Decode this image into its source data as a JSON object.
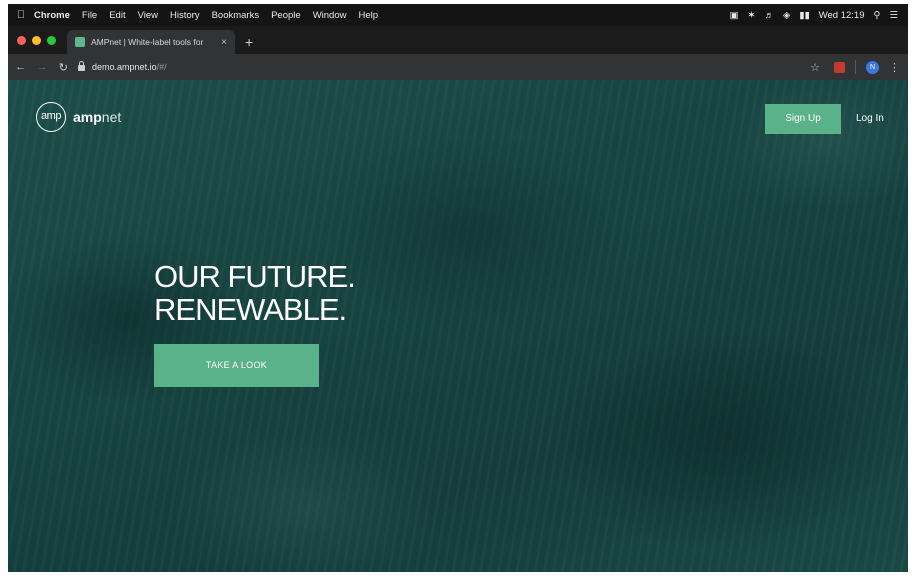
{
  "menubar": {
    "app_name": "Chrome",
    "items": [
      "File",
      "Edit",
      "View",
      "History",
      "Bookmarks",
      "People",
      "Window",
      "Help"
    ],
    "clock": "Wed 12:19"
  },
  "browser": {
    "tab_title": "AMPnet | White-label tools for",
    "tab_close": "×",
    "new_tab": "+",
    "url_domain": "demo.ampnet.io",
    "url_path": "/#/",
    "profile_initial": "N"
  },
  "page": {
    "logo_mark": "amp",
    "logo_word_bold": "amp",
    "logo_word_light": "net",
    "signup_label": "Sign Up",
    "login_label": "Log In",
    "hero_line1": "OUR FUTURE.",
    "hero_line2": "RENEWABLE.",
    "cta_label": "TAKE A LOOK"
  },
  "colors": {
    "accent_green": "#5ab28a",
    "ocean_teal": "#174542",
    "close_red": "#ff5f57",
    "minimize_yellow": "#febc2e",
    "zoom_green": "#28c840"
  }
}
